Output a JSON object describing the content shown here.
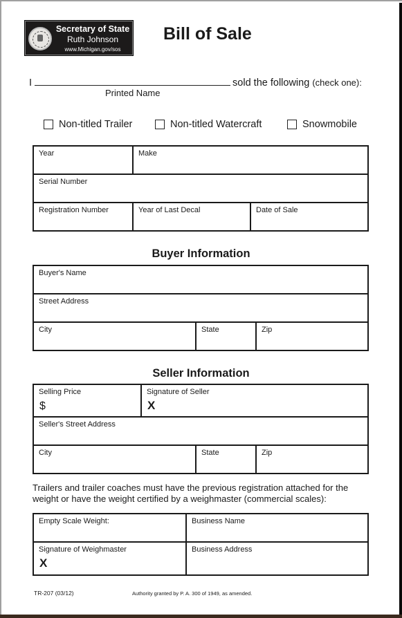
{
  "header": {
    "logo": {
      "title": "Secretary of State",
      "name": "Ruth Johnson",
      "url": "www.Michigan.gov/sos",
      "icon": "state-seal-icon"
    },
    "title": "Bill of Sale"
  },
  "intro": {
    "prefix": "I",
    "suffix": "sold the following",
    "suffix_paren": "(check one):",
    "printed_name_label": "Printed Name",
    "printed_name_value": ""
  },
  "options": [
    {
      "label": "Non-titled Trailer",
      "checked": false
    },
    {
      "label": "Non-titled Watercraft",
      "checked": false
    },
    {
      "label": "Snowmobile",
      "checked": false
    }
  ],
  "vehicle": {
    "year_label": "Year",
    "make_label": "Make",
    "serial_label": "Serial Number",
    "registration_label": "Registration Number",
    "last_decal_label": "Year of Last Decal",
    "date_of_sale_label": "Date of Sale"
  },
  "buyer": {
    "section_title": "Buyer Information",
    "name_label": "Buyer's Name",
    "street_label": "Street Address",
    "city_label": "City",
    "state_label": "State",
    "zip_label": "Zip"
  },
  "seller": {
    "section_title": "Seller Information",
    "price_label": "Selling Price",
    "price_prefix": "$",
    "signature_label": "Signature of Seller",
    "signature_mark": "X",
    "street_label": "Seller's Street Address",
    "city_label": "City",
    "state_label": "State",
    "zip_label": "Zip"
  },
  "weight": {
    "note": "Trailers and trailer coaches must have the previous registration attached for the weight or have the weight certified by a weighmaster (commercial scales):",
    "empty_weight_label": "Empty Scale Weight:",
    "business_name_label": "Business Name",
    "weighmaster_signature_label": "Signature of Weighmaster",
    "signature_mark": "X",
    "business_address_label": "Business Address"
  },
  "footer": {
    "form_code": "TR-207 (03/12)",
    "authority": "Authority granted by P. A. 300 of 1949, as amended."
  }
}
